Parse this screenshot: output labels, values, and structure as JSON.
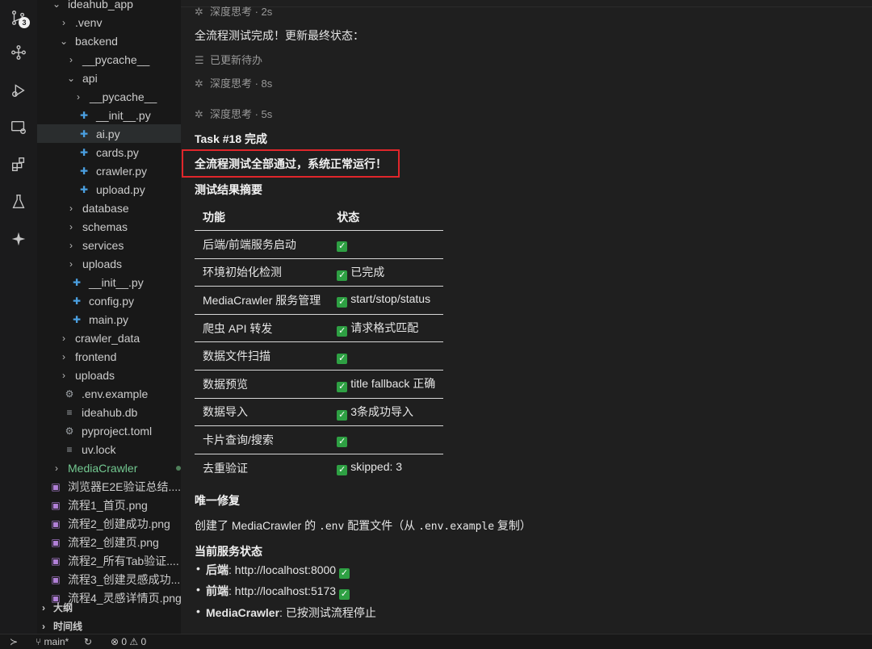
{
  "activity": {
    "scm_badge": "3"
  },
  "explorer": {
    "rows": [
      {
        "label": "ideahub_app",
        "depth": 1,
        "kind": "folder-open"
      },
      {
        "label": ".venv",
        "depth": 2,
        "kind": "folder"
      },
      {
        "label": "backend",
        "depth": 2,
        "kind": "folder-open"
      },
      {
        "label": "__pycache__",
        "depth": 3,
        "kind": "folder"
      },
      {
        "label": "api",
        "depth": 3,
        "kind": "folder-open"
      },
      {
        "label": "__pycache__",
        "depth": 4,
        "kind": "folder"
      },
      {
        "label": "__init__.py",
        "depth": 4,
        "kind": "py"
      },
      {
        "label": "ai.py",
        "depth": 4,
        "kind": "py",
        "active": true
      },
      {
        "label": "cards.py",
        "depth": 4,
        "kind": "py"
      },
      {
        "label": "crawler.py",
        "depth": 4,
        "kind": "py"
      },
      {
        "label": "upload.py",
        "depth": 4,
        "kind": "py"
      },
      {
        "label": "database",
        "depth": 3,
        "kind": "folder"
      },
      {
        "label": "schemas",
        "depth": 3,
        "kind": "folder"
      },
      {
        "label": "services",
        "depth": 3,
        "kind": "folder"
      },
      {
        "label": "uploads",
        "depth": 3,
        "kind": "folder"
      },
      {
        "label": "__init__.py",
        "depth": 3,
        "kind": "py"
      },
      {
        "label": "config.py",
        "depth": 3,
        "kind": "py"
      },
      {
        "label": "main.py",
        "depth": 3,
        "kind": "py"
      },
      {
        "label": "crawler_data",
        "depth": 2,
        "kind": "folder"
      },
      {
        "label": "frontend",
        "depth": 2,
        "kind": "folder"
      },
      {
        "label": "uploads",
        "depth": 2,
        "kind": "folder"
      },
      {
        "label": ".env.example",
        "depth": 2,
        "kind": "gear"
      },
      {
        "label": "ideahub.db",
        "depth": 2,
        "kind": "lines"
      },
      {
        "label": "pyproject.toml",
        "depth": 2,
        "kind": "gear"
      },
      {
        "label": "uv.lock",
        "depth": 2,
        "kind": "lines"
      },
      {
        "label": "MediaCrawler",
        "depth": 1,
        "kind": "folder-modified"
      },
      {
        "label": "浏览器E2E验证总结....",
        "depth": 1,
        "kind": "img"
      },
      {
        "label": "流程1_首页.png",
        "depth": 1,
        "kind": "img"
      },
      {
        "label": "流程2_创建成功.png",
        "depth": 1,
        "kind": "img"
      },
      {
        "label": "流程2_创建页.png",
        "depth": 1,
        "kind": "img"
      },
      {
        "label": "流程2_所有Tab验证....",
        "depth": 1,
        "kind": "img"
      },
      {
        "label": "流程3_创建灵感成功....",
        "depth": 1,
        "kind": "img"
      },
      {
        "label": "流程4_灵感详情页.png",
        "depth": 1,
        "kind": "img"
      }
    ],
    "outline": "大纲",
    "timeline": "时间线"
  },
  "chat": {
    "thinking_top": "深度思考 · 2s",
    "intro": "全流程测试完成！更新最终状态：",
    "todo_updated": "已更新待办",
    "thinking_8s": "深度思考 · 8s",
    "thinking_5s": "深度思考 · 5s",
    "task_title": "Task #18 完成",
    "headline": "全流程测试全部通过，系统正常运行！",
    "summary_title": "测试结果摘要",
    "table_headers": [
      "功能",
      "状态"
    ],
    "table_rows": [
      {
        "feature": "后端/前端服务启动",
        "status": ""
      },
      {
        "feature": "环境初始化检测",
        "status": "已完成"
      },
      {
        "feature": "MediaCrawler 服务管理",
        "status": "start/stop/status"
      },
      {
        "feature": "爬虫 API 转发",
        "status": "请求格式匹配"
      },
      {
        "feature": "数据文件扫描",
        "status": ""
      },
      {
        "feature": "数据预览",
        "status": "title fallback 正确"
      },
      {
        "feature": "数据导入",
        "status": "3条成功导入"
      },
      {
        "feature": "卡片查询/搜索",
        "status": ""
      },
      {
        "feature": "去重验证",
        "status": "skipped: 3"
      }
    ],
    "fix_title": "唯一修复",
    "fix_prefix": "创建了 MediaCrawler 的 ",
    "fix_code1": ".env",
    "fix_mid": " 配置文件（从 ",
    "fix_code2": ".env.example",
    "fix_suffix": " 复制）",
    "service_title": "当前服务状态",
    "services": [
      {
        "name": "后端",
        "value": ": http://localhost:8000",
        "check": true
      },
      {
        "name": "前端",
        "value": ": http://localhost:5173",
        "check": true
      },
      {
        "name": "MediaCrawler",
        "value": ": 已按测试流程停止",
        "check": false
      }
    ]
  },
  "status_bar": {
    "branch": "main*",
    "errors": "0",
    "warnings": "0"
  }
}
